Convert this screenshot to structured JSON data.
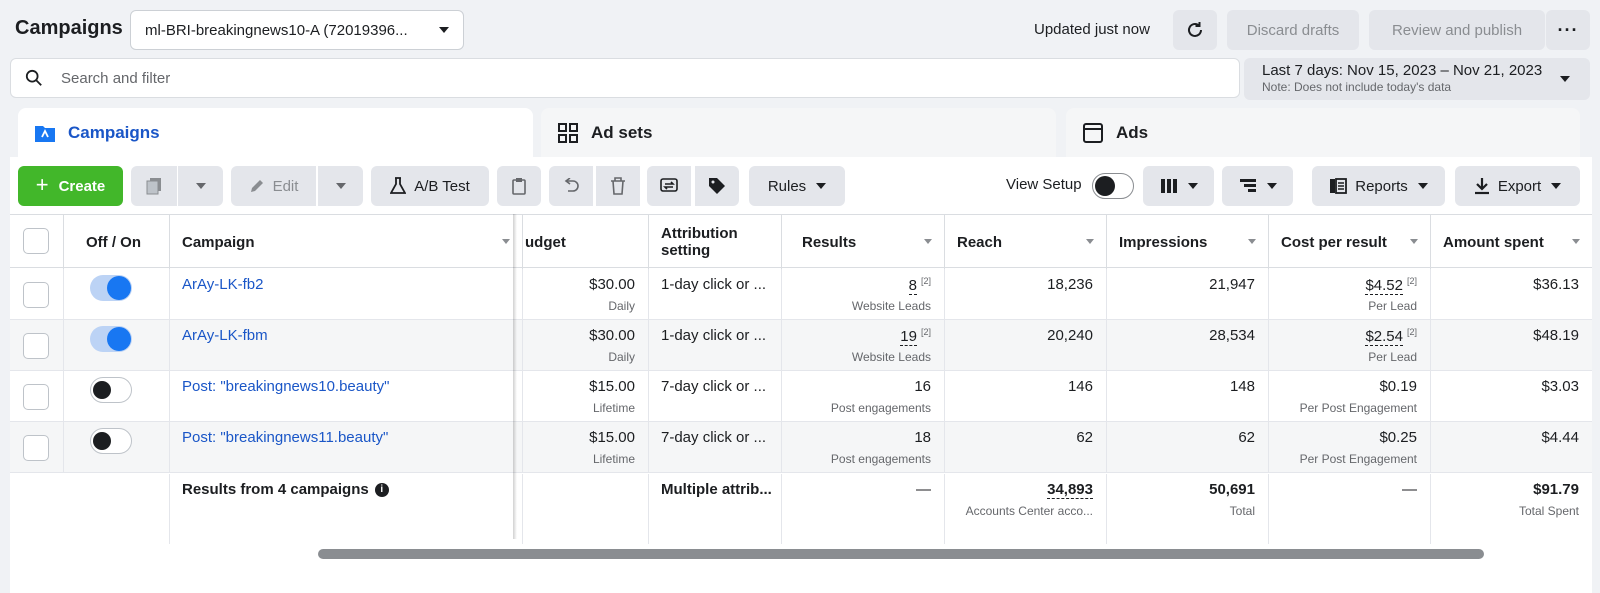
{
  "header": {
    "title": "Campaigns",
    "account_select": "ml-BRI-breakingnews10-A (72019396...",
    "updated": "Updated just now",
    "discard": "Discard drafts",
    "review": "Review and publish",
    "more": "···"
  },
  "search": {
    "placeholder": "Search and filter"
  },
  "date_range": {
    "label": "Last 7 days: Nov 15, 2023 – Nov 21, 2023",
    "note": "Note: Does not include today's data"
  },
  "tabs": [
    {
      "label": "Campaigns",
      "active": true
    },
    {
      "label": "Ad sets",
      "active": false
    },
    {
      "label": "Ads",
      "active": false
    }
  ],
  "toolbar": {
    "create": "Create",
    "edit": "Edit",
    "ab_test": "A/B Test",
    "rules": "Rules",
    "view_setup": "View Setup",
    "reports": "Reports",
    "export": "Export"
  },
  "table": {
    "headers": {
      "onoff": "Off / On",
      "campaign": "Campaign",
      "budget": "udget",
      "attribution": "Attribution setting",
      "results": "Results",
      "reach": "Reach",
      "impressions": "Impressions",
      "cpr": "Cost per result",
      "spent": "Amount spent"
    },
    "rows": [
      {
        "on": true,
        "name": "ArAy-LK-fb2",
        "budget": "$30.00",
        "budget_sub": "Daily",
        "attribution": "1-day click or ...",
        "results": "8",
        "results_sup": "[2]",
        "results_sub": "Website Leads",
        "reach": "18,236",
        "impressions": "21,947",
        "cpr": "$4.52",
        "cpr_sup": "[2]",
        "cpr_sub": "Per Lead",
        "spent": "$36.13"
      },
      {
        "on": true,
        "name": "ArAy-LK-fbm",
        "budget": "$30.00",
        "budget_sub": "Daily",
        "attribution": "1-day click or ...",
        "results": "19",
        "results_sup": "[2]",
        "results_sub": "Website Leads",
        "reach": "20,240",
        "impressions": "28,534",
        "cpr": "$2.54",
        "cpr_sup": "[2]",
        "cpr_sub": "Per Lead",
        "spent": "$48.19"
      },
      {
        "on": false,
        "name": "Post: \"breakingnews10.beauty\"",
        "budget": "$15.00",
        "budget_sub": "Lifetime",
        "attribution": "7-day click or ...",
        "results": "16",
        "results_sup": "",
        "results_sub": "Post engagements",
        "reach": "146",
        "impressions": "148",
        "cpr": "$0.19",
        "cpr_sup": "",
        "cpr_sub": "Per Post Engagement",
        "spent": "$3.03"
      },
      {
        "on": false,
        "name": "Post: \"breakingnews11.beauty\"",
        "budget": "$15.00",
        "budget_sub": "Lifetime",
        "attribution": "7-day click or ...",
        "results": "18",
        "results_sup": "",
        "results_sub": "Post engagements",
        "reach": "62",
        "impressions": "62",
        "cpr": "$0.25",
        "cpr_sup": "",
        "cpr_sub": "Per Post Engagement",
        "spent": "$4.44"
      }
    ],
    "totals": {
      "label": "Results from 4 campaigns",
      "attribution": "Multiple attrib...",
      "results": "—",
      "reach": "34,893",
      "reach_sub": "Accounts Center acco...",
      "impressions": "50,691",
      "impressions_sub": "Total",
      "cpr": "—",
      "spent": "$91.79",
      "spent_sub": "Total Spent"
    }
  },
  "colors": {
    "accent": "#1877f2",
    "link": "#1a56c7",
    "create": "#42b72a"
  }
}
